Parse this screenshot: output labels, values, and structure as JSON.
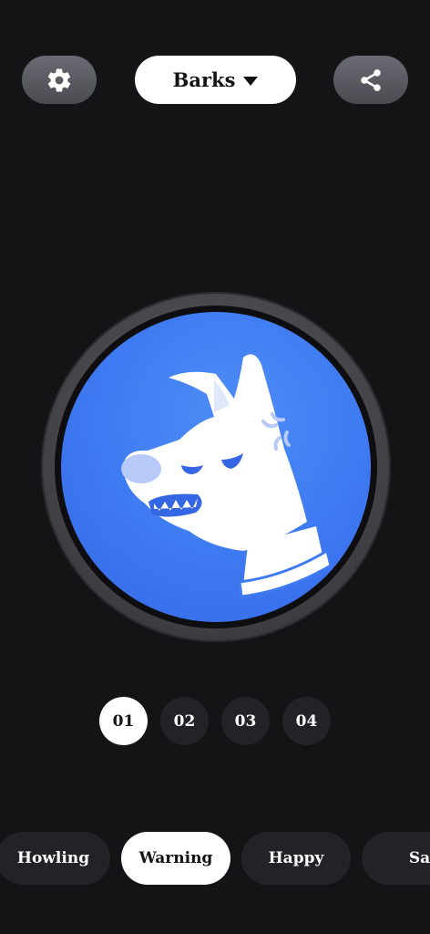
{
  "header": {
    "category_label": "Barks",
    "settings_icon": "gear-icon",
    "share_icon": "share-icon",
    "dropdown_icon": "caret-down-icon"
  },
  "main": {
    "button_icon": "angry-dog-icon",
    "button_color": "#3e7af2"
  },
  "slots": [
    {
      "label": "01",
      "active": true
    },
    {
      "label": "02",
      "active": false
    },
    {
      "label": "03",
      "active": false
    },
    {
      "label": "04",
      "active": false
    }
  ],
  "moods": [
    {
      "label": "Howling",
      "active": false
    },
    {
      "label": "Warning",
      "active": true
    },
    {
      "label": "Happy",
      "active": false
    },
    {
      "label": "Sad",
      "active": false
    }
  ]
}
